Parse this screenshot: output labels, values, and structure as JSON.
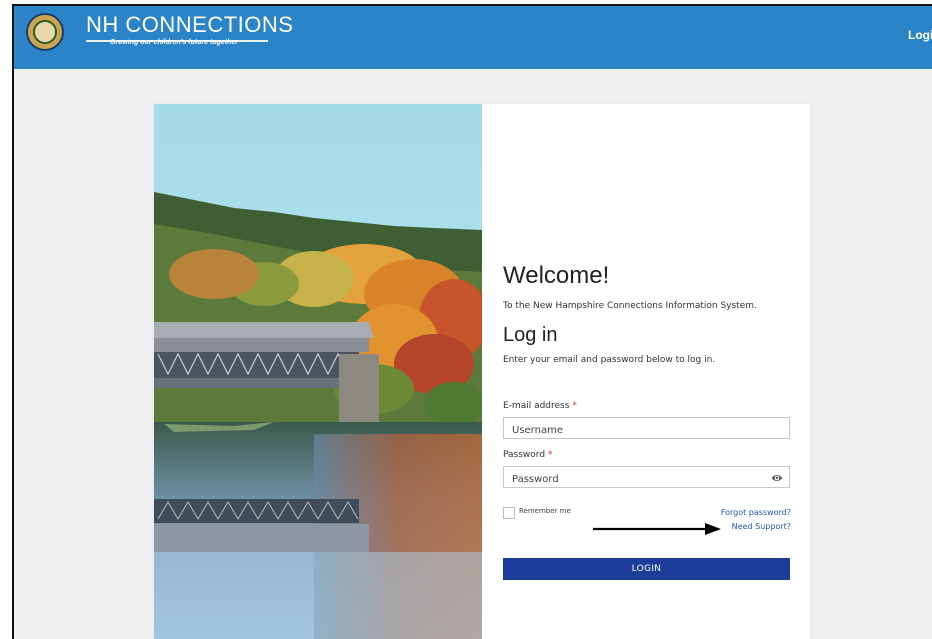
{
  "header": {
    "brand_title": "NH CONNECTIONS",
    "tagline": "Growing our children's future together",
    "nav_login": "Login",
    "seal_icon": "nh-state-seal-icon",
    "bar_color": "#2b83c8"
  },
  "hero_image": {
    "icon": "covered-bridge-autumn-photo"
  },
  "login": {
    "welcome_heading": "Welcome!",
    "welcome_subtitle": "To the New Hampshire Connections Information System.",
    "heading": "Log in",
    "instructions": "Enter your email and password below to log in.",
    "email_label": "E-mail address",
    "email_placeholder": "Username",
    "password_label": "Password",
    "password_placeholder": "Password",
    "required_mark": "*",
    "show_password_icon": "eye-icon",
    "remember_label": "Remember me",
    "forgot_link": "Forgot password?",
    "support_link": "Need Support?",
    "annotation_icon": "arrow-right-icon",
    "login_button": "LOGIN",
    "button_color": "#1b3d99"
  }
}
